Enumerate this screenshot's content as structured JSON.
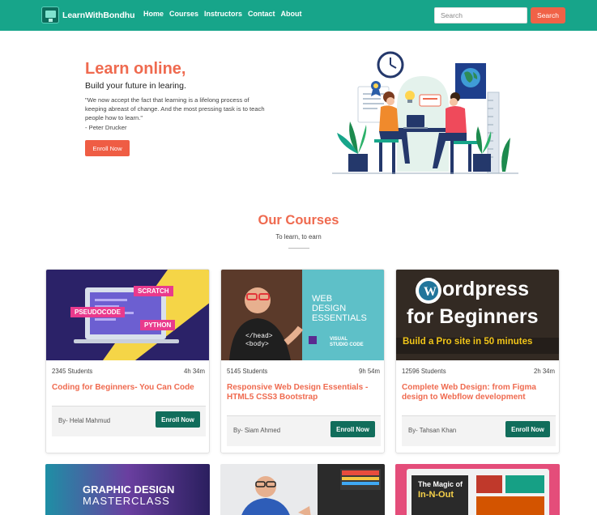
{
  "navbar": {
    "brand": "LearnWithBondhu",
    "links": [
      "Home",
      "Courses",
      "Instructors",
      "Contact",
      "About"
    ],
    "search_placeholder": "Search",
    "search_button": "Search"
  },
  "hero": {
    "title": "Learn online,",
    "subtitle": "Build your future in learing.",
    "quote": "\"We now accept the fact that learning is a lifelong process of keeping abreast of change. And the most pressing task is to teach people how to learn.\"",
    "author": "- Peter Drucker",
    "cta": "Enroll Now"
  },
  "courses_section": {
    "title": "Our Courses",
    "subtitle": "To learn, to earn"
  },
  "courses": [
    {
      "students": "2345 Students",
      "duration": "4h 34m",
      "title": "Coding for Beginners- You Can Code",
      "author": "By- Helal Mahmud",
      "cta": "Enroll Now",
      "thumb_text": [
        "SCRATCH",
        "PSEUDOCODE",
        "PYTHON"
      ]
    },
    {
      "students": "5145 Students",
      "duration": "9h 54m",
      "title": "Responsive Web Design Essentials - HTML5 CSS3 Bootstrap",
      "author": "By- Siam Ahmed",
      "cta": "Enroll Now",
      "thumb_text": [
        "WEB",
        "DESIGN",
        "ESSENTIALS",
        "VISUAL",
        "STUDIO CODE",
        "</head>",
        "<body>"
      ]
    },
    {
      "students": "12596 Students",
      "duration": "2h 34m",
      "title": "Complete Web Design: from Figma design to Webflow development",
      "author": "By- Tahsan Khan",
      "cta": "Enroll Now",
      "thumb_text": [
        "ordpress",
        "for Beginners",
        "Build a Pro site in 50 minutes"
      ]
    }
  ],
  "more_courses": [
    {
      "thumb_text": [
        "GRAPHIC DESIGN",
        "MASTERCLASS"
      ]
    },
    {
      "thumb_text": []
    },
    {
      "thumb_text": [
        "The Magic of",
        "In-N-Out"
      ]
    }
  ],
  "colors": {
    "primary": "#17a58a",
    "accent": "#ef6a4f",
    "button_dark": "#116d5b"
  },
  "icons": [
    "monitor-logo-icon",
    "clock-icon",
    "globe-icon",
    "lightbulb-icon",
    "plant-icon",
    "award-icon"
  ]
}
